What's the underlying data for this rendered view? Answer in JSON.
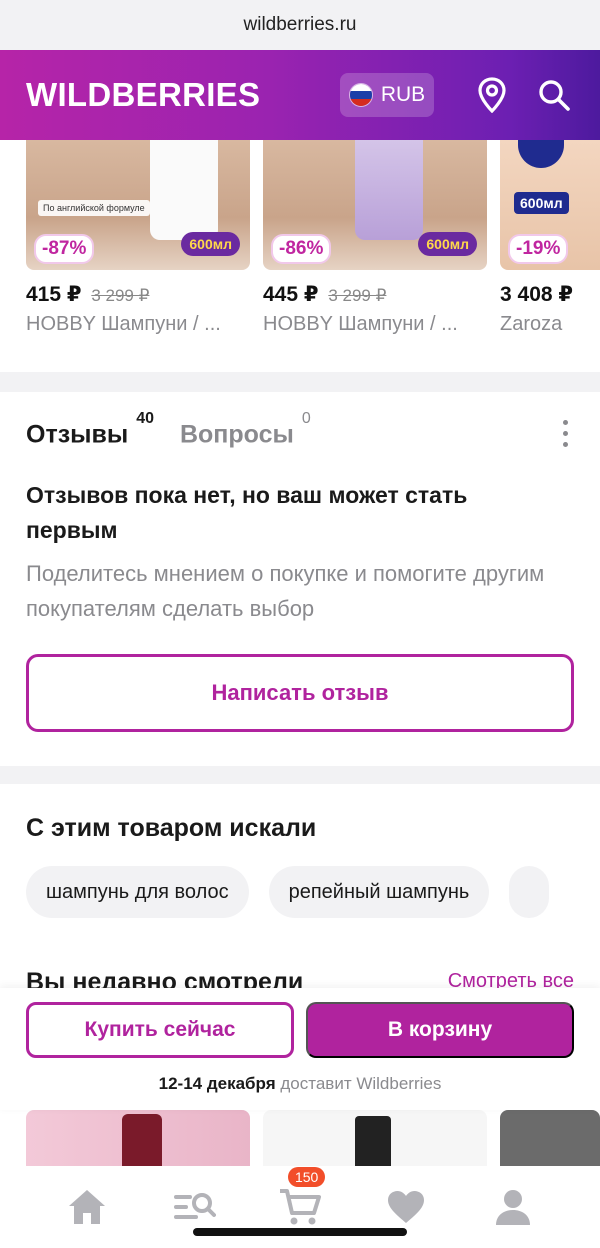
{
  "browser": {
    "url": "wildberries.ru"
  },
  "header": {
    "logo": "WILDBERRIES",
    "currency": "RUB",
    "icons": [
      "location-pin-icon",
      "search-icon"
    ],
    "brand_color": "#9a23b0"
  },
  "products": [
    {
      "price": "415 ₽",
      "old_price": "3 299 ₽",
      "name": "HOBBY Шампуни / ...",
      "discount": "-87%",
      "volume": "600мл",
      "badge": "По английской формуле"
    },
    {
      "price": "445 ₽",
      "old_price": "3 299 ₽",
      "name": "HOBBY Шампуни / ...",
      "discount": "-86%",
      "volume": "600мл"
    },
    {
      "price": "3 408 ₽",
      "name": "Zaroza",
      "discount": "-19%",
      "volume": "600мл"
    }
  ],
  "reviews": {
    "tab_reviews": "Отзывы",
    "reviews_count": "40",
    "tab_questions": "Вопросы",
    "questions_count": "0",
    "empty_title": "Отзывов пока нет, но ваш может стать первым",
    "empty_text": "Поделитесь мнением о покупке и помогите другим покупателям сделать выбор",
    "write_button": "Написать отзыв"
  },
  "searched": {
    "title": "С этим товаром искали",
    "chips": [
      "шампунь для волос",
      "репейный шампунь"
    ]
  },
  "recent": {
    "title": "Вы недавно смотрели",
    "see_all": "Смотреть все"
  },
  "buybar": {
    "buy_now": "Купить сейчас",
    "to_cart": "В корзину",
    "delivery_date": "12-14 декабря",
    "delivery_text": " доставит Wildberries"
  },
  "bottom_nav": {
    "items": [
      "home-icon",
      "catalog-icon",
      "cart-icon",
      "favorites-icon",
      "profile-icon"
    ],
    "cart_badge": "150"
  }
}
